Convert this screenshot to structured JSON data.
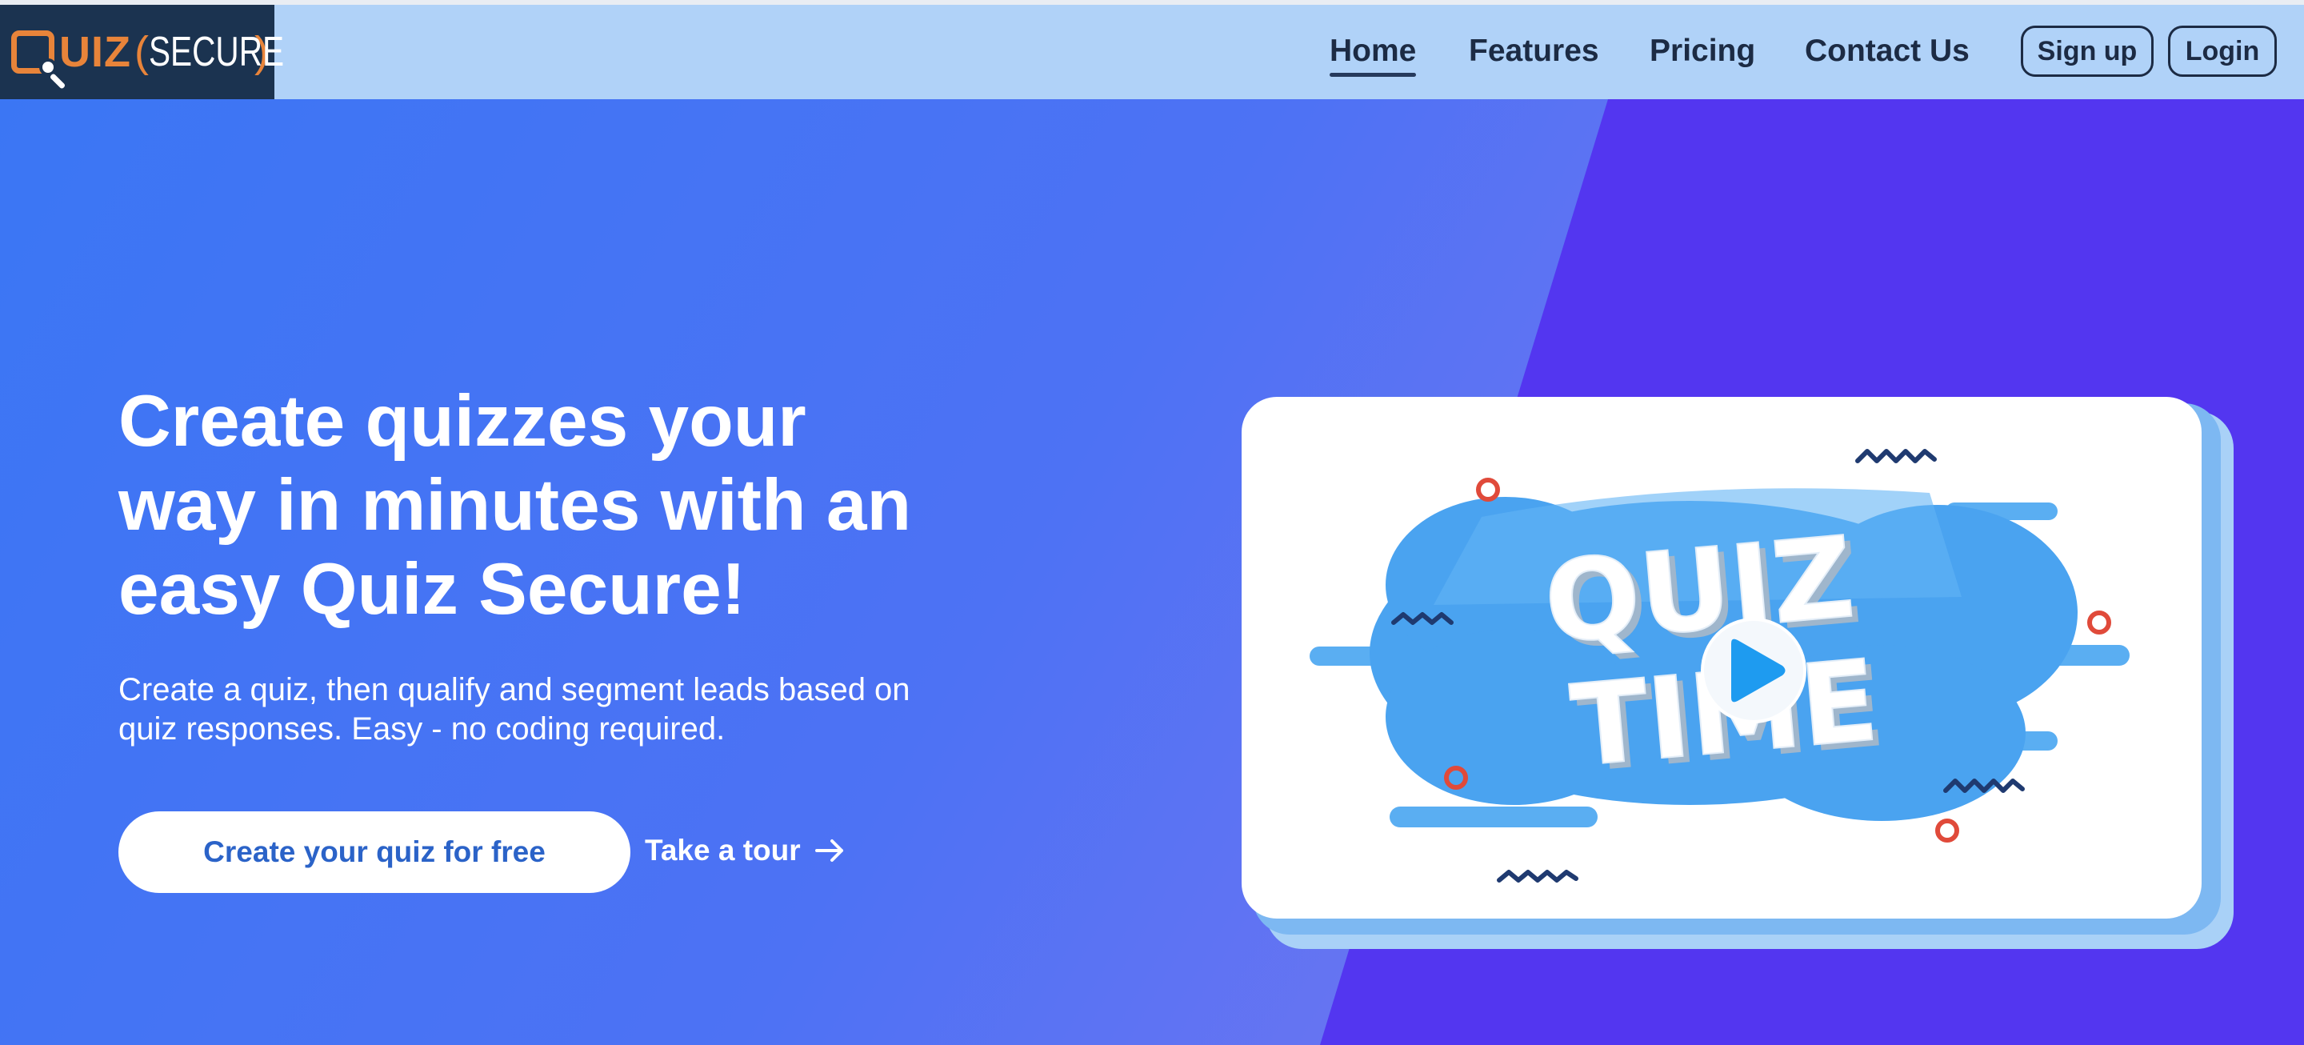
{
  "logo": {
    "letter": "Q",
    "text_uiz": "UIZ",
    "text_secure": "SECURE",
    "bracket_open": "(",
    "bracket_close": ")"
  },
  "nav": {
    "items": [
      {
        "label": "Home",
        "active": true
      },
      {
        "label": "Features",
        "active": false
      },
      {
        "label": "Pricing",
        "active": false
      },
      {
        "label": "Contact Us",
        "active": false
      }
    ],
    "signup_label": "Sign up",
    "login_label": "Login"
  },
  "hero": {
    "headline": "Create quizzes your way in minutes with an easy Quiz Secure!",
    "subtext": "Create a quiz, then qualify and segment leads based on quiz responses. Easy - no coding required.",
    "cta_primary": "Create your quiz for free",
    "cta_secondary": "Take a tour",
    "cta_secondary_icon": "arrow-right-icon"
  },
  "card": {
    "title_line1": "QUIZ",
    "title_line2": "TIME",
    "icon": "play-icon"
  },
  "colors": {
    "header_bg": "#b0d2f8",
    "logo_bg": "#1b3350",
    "logo_accent": "#e8843a",
    "hero_blue": "#3b76f4",
    "hero_purple": "#5336f0",
    "cta_text": "#2b63c8",
    "play_blue": "#1e9bf0"
  }
}
